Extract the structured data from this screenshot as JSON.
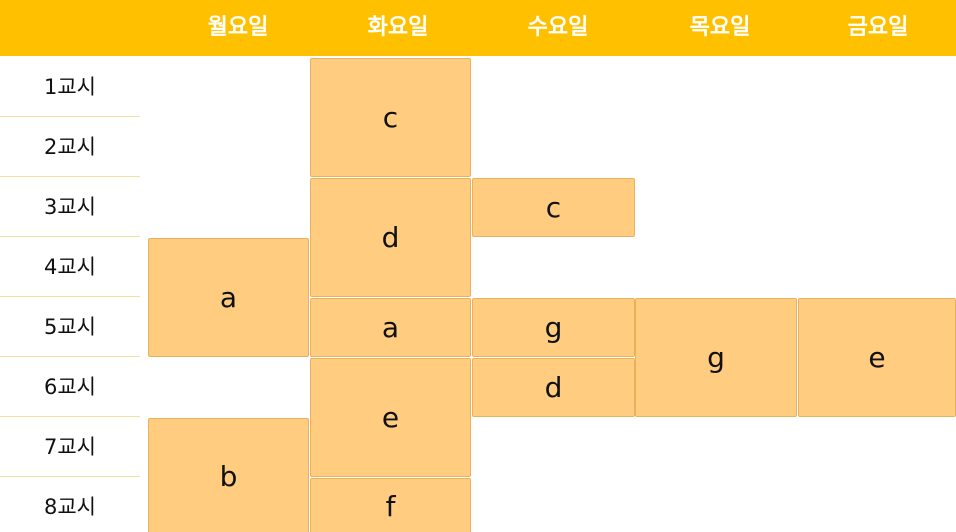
{
  "colors": {
    "header_bg": "#ffc000",
    "cell_bg": "#ffcc80",
    "header_text": "#ffffff"
  },
  "days": [
    "월요일",
    "화요일",
    "수요일",
    "목요일",
    "금요일"
  ],
  "periods": [
    "1교시",
    "2교시",
    "3교시",
    "4교시",
    "5교시",
    "6교시",
    "7교시",
    "8교시"
  ],
  "classes": {
    "mon_a": "a",
    "mon_b": "b",
    "tue_c": "c",
    "tue_d": "d",
    "tue_a": "a",
    "tue_e": "e",
    "tue_f": "f",
    "wed_c": "c",
    "wed_g": "g",
    "wed_d": "d",
    "thu_g": "g",
    "fri_e": "e"
  }
}
